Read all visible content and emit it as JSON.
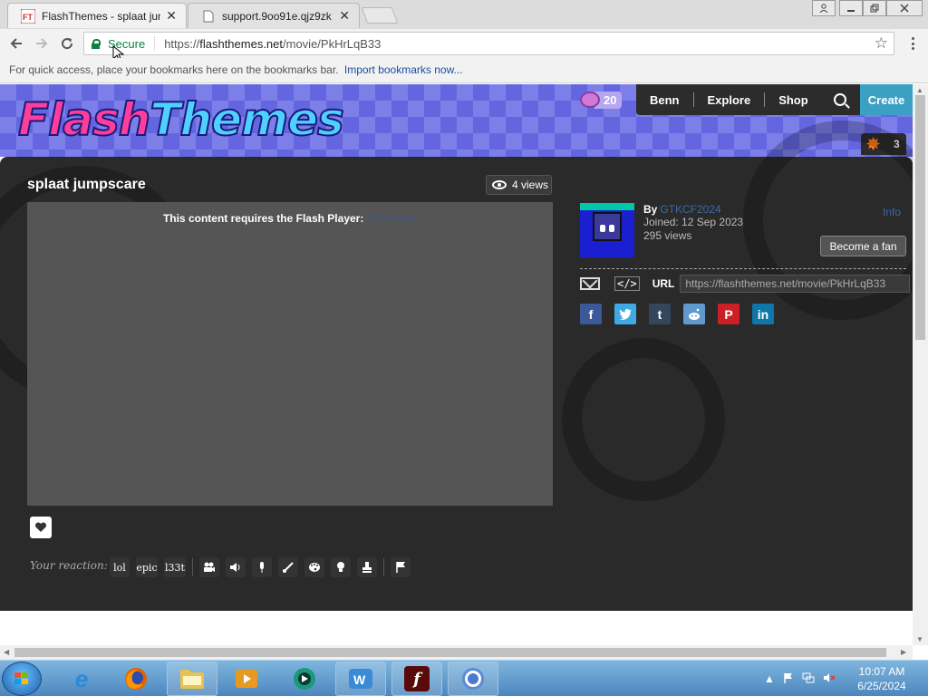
{
  "browser": {
    "tabs": [
      {
        "title": "FlashThemes - splaat jum",
        "active": true,
        "favicon": "FT"
      },
      {
        "title": "support.9oo91e.qjz9zk",
        "active": false
      }
    ],
    "address": {
      "secure_label": "Secure",
      "scheme": "https://",
      "host": "flashthemes.net",
      "path": "/movie/PkHrLqB33"
    },
    "bookmarks_hint": "For quick access, place your bookmarks here on the bookmarks bar.",
    "import_link": "Import bookmarks now..."
  },
  "site": {
    "logo": {
      "part1": "Flash",
      "part2": "Themes"
    },
    "coins": "20",
    "nav": [
      {
        "label": "Benn"
      },
      {
        "label": "Explore"
      },
      {
        "label": "Shop"
      }
    ],
    "create_label": "Create",
    "notifications": "3"
  },
  "video": {
    "title": "splaat jumpscare",
    "views_label": "4 views",
    "player_message": "This content requires the Flash Player:",
    "download_link": "Download"
  },
  "author": {
    "by_label": "By",
    "name": "GTKCF2024",
    "joined": "Joined: 12 Sep 2023",
    "views": "295 views",
    "info_link": "Info",
    "fan_button": "Become a fan"
  },
  "share": {
    "url_label": "URL",
    "url_value": "https://flashthemes.net/movie/PkHrLqB33",
    "embed_label": "</>",
    "socials": [
      "facebook",
      "twitter",
      "tumblr",
      "reddit",
      "pinterest",
      "linkedin"
    ]
  },
  "reactions": {
    "label": "Your reaction:",
    "text_items": [
      "lol",
      "epic",
      "l33t"
    ]
  },
  "taskbar": {
    "time": "10:07 AM",
    "date": "6/25/2024"
  },
  "colors": {
    "accent": "#3aa0c4",
    "banner_light": "#7d7fe8",
    "banner_dark": "#6466e0",
    "content_bg": "#2a2a2a",
    "link": "#3a6aa8",
    "secure": "#0b8043"
  }
}
